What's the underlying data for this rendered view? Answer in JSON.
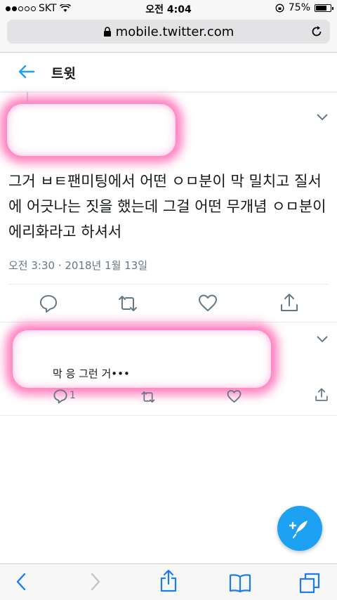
{
  "status_bar": {
    "carrier": "SKT",
    "time": "오전 4:04",
    "battery": "75%",
    "battery_level": 0.75
  },
  "browser": {
    "url": "mobile.twitter.com"
  },
  "header": {
    "title": "트윗"
  },
  "tweet": {
    "text": "그거 ㅂㅌ팬미팅에서 어떤 ㅇㅁ분이 막 밀치고 질서에 어긋나는 짓을 했는데 그걸 어떤 무개념 ㅇㅁ분이 에리화라고 하셔서",
    "timestamp": "오전 3:30 · 2018년 1월 13일"
  },
  "reply": {
    "text": "막 응 그런 거•••",
    "reply_count": "1"
  },
  "colors": {
    "accent": "#1da1f2",
    "redaction": "#ff69b4",
    "muted": "#657786"
  },
  "icons": [
    "lock-icon",
    "reload-icon",
    "back-arrow-icon",
    "chevron-down-icon",
    "reply-icon",
    "retweet-icon",
    "like-icon",
    "share-icon",
    "compose-icon",
    "browser-back-icon",
    "browser-forward-icon",
    "bookmarks-icon",
    "tabs-icon"
  ]
}
